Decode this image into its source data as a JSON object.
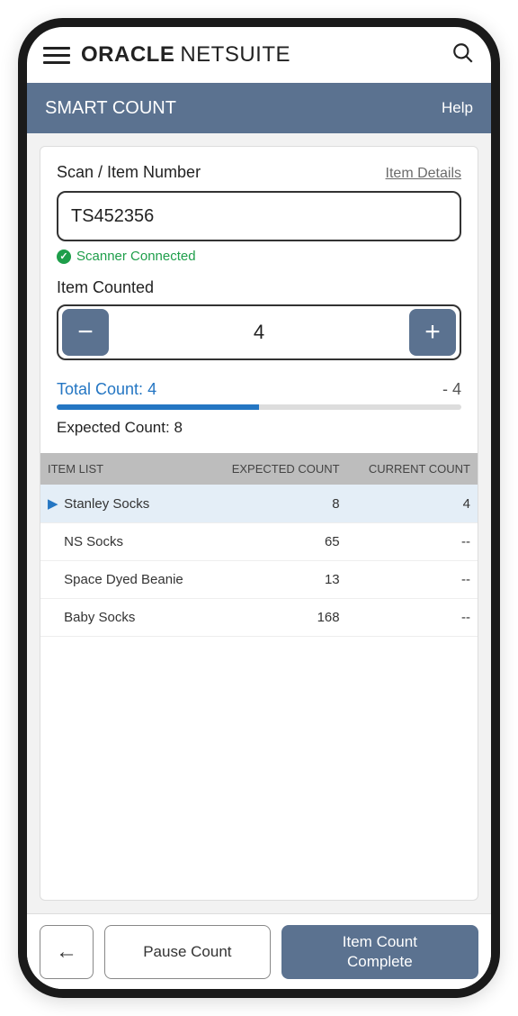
{
  "header": {
    "brand_bold": "ORACLE",
    "brand_light": "NETSUITE"
  },
  "titlebar": {
    "title": "SMART COUNT",
    "help": "Help"
  },
  "scan": {
    "label": "Scan / Item Number",
    "details_link": "Item Details",
    "value": "TS452356",
    "status": "Scanner Connected"
  },
  "counter": {
    "label": "Item Counted",
    "value": "4"
  },
  "totals": {
    "total_label": "Total Count:",
    "total_value": "4",
    "diff": "- 4",
    "expected_label": "Expected Count:",
    "expected_value": "8",
    "progress_pct": 50
  },
  "table": {
    "headers": {
      "item": "ITEM LIST",
      "expected": "EXPECTED COUNT",
      "current": "CURRENT COUNT"
    },
    "rows": [
      {
        "name": "Stanley Socks",
        "expected": "8",
        "current": "4",
        "active": true
      },
      {
        "name": "NS Socks",
        "expected": "65",
        "current": "--",
        "active": false
      },
      {
        "name": "Space Dyed Beanie",
        "expected": "13",
        "current": "--",
        "active": false
      },
      {
        "name": "Baby Socks",
        "expected": "168",
        "current": "--",
        "active": false
      }
    ]
  },
  "footer": {
    "pause": "Pause Count",
    "complete": "Item Count Complete"
  }
}
